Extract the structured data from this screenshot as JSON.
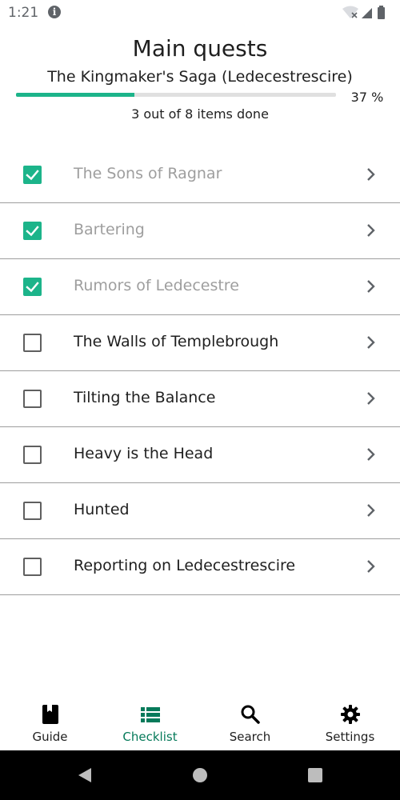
{
  "status_bar": {
    "time": "1:21",
    "icons": [
      "info-icon",
      "wifi-icon",
      "signal-icon",
      "battery-icon"
    ]
  },
  "header": {
    "title": "Main quests",
    "subtitle": "The Kingmaker's Saga (Ledecestrescire)",
    "progress_percent": "37 %",
    "progress_fraction": 0.37,
    "progress_caption": "3 out of 8 items done"
  },
  "colors": {
    "accent": "#1cb48a",
    "active_nav": "#067a5a",
    "done_text": "#9e9e9e"
  },
  "checklist": {
    "items": [
      {
        "label": "The Sons of Ragnar",
        "checked": true
      },
      {
        "label": "Bartering",
        "checked": true
      },
      {
        "label": "Rumors of Ledecestre",
        "checked": true
      },
      {
        "label": "The Walls of Templebrough",
        "checked": false
      },
      {
        "label": "Tilting the Balance",
        "checked": false
      },
      {
        "label": "Heavy is the Head",
        "checked": false
      },
      {
        "label": "Hunted",
        "checked": false
      },
      {
        "label": "Reporting on Ledecestrescire",
        "checked": false
      }
    ]
  },
  "bottom_nav": {
    "items": [
      {
        "label": "Guide",
        "icon": "book-icon",
        "active": false
      },
      {
        "label": "Checklist",
        "icon": "list-icon",
        "active": true
      },
      {
        "label": "Search",
        "icon": "search-icon",
        "active": false
      },
      {
        "label": "Settings",
        "icon": "gear-icon",
        "active": false
      }
    ]
  },
  "system_nav": {
    "icons": [
      "back-icon",
      "home-icon",
      "recents-icon"
    ]
  }
}
